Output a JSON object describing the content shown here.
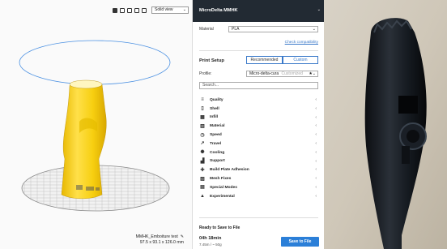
{
  "view": {
    "view_mode": "Solid view",
    "model_name": "MMHK_Emboiture test",
    "model_dims": "97.5 x 93.1 x 126.0 mm"
  },
  "panel": {
    "printer_name": "MicroDelta MMHK",
    "material_label": "Material",
    "material_value": "PLA",
    "compat_link": "Check compatibility",
    "print_setup_title": "Print Setup",
    "tab_recommended": "Recommended",
    "tab_custom": "Custom",
    "profile_label": "Profile:",
    "profile_value": "Micro-delta-cura",
    "profile_suffix": "Customized",
    "search_placeholder": "Search...",
    "categories": [
      {
        "label": "Quality",
        "icon": "quality-icon",
        "glyph": "≡"
      },
      {
        "label": "Shell",
        "icon": "shell-icon",
        "glyph": "▯"
      },
      {
        "label": "Infill",
        "icon": "infill-icon",
        "glyph": "▦"
      },
      {
        "label": "Material",
        "icon": "material-icon",
        "glyph": "▥"
      },
      {
        "label": "Speed",
        "icon": "speed-icon",
        "glyph": "◷"
      },
      {
        "label": "Travel",
        "icon": "travel-icon",
        "glyph": "↗"
      },
      {
        "label": "Cooling",
        "icon": "cooling-icon",
        "glyph": "✺"
      },
      {
        "label": "Support",
        "icon": "support-icon",
        "glyph": "▟"
      },
      {
        "label": "Build Plate Adhesion",
        "icon": "adhesion-icon",
        "glyph": "✚"
      },
      {
        "label": "Mesh Fixes",
        "icon": "mesh-fixes-icon",
        "glyph": "▨"
      },
      {
        "label": "Special Modes",
        "icon": "special-modes-icon",
        "glyph": "▤"
      },
      {
        "label": "Experimental",
        "icon": "experimental-icon",
        "glyph": "▲"
      }
    ],
    "ready_text": "Ready to Save to File",
    "print_time": "04h 18min",
    "material_usage": "7.45m / ~ 50g",
    "save_button": "Save to File"
  },
  "colors": {
    "header_bg": "#222a33",
    "accent": "#2b7fd8",
    "model_yellow": "#f8d21a",
    "circle_blue": "#4a90e2"
  }
}
